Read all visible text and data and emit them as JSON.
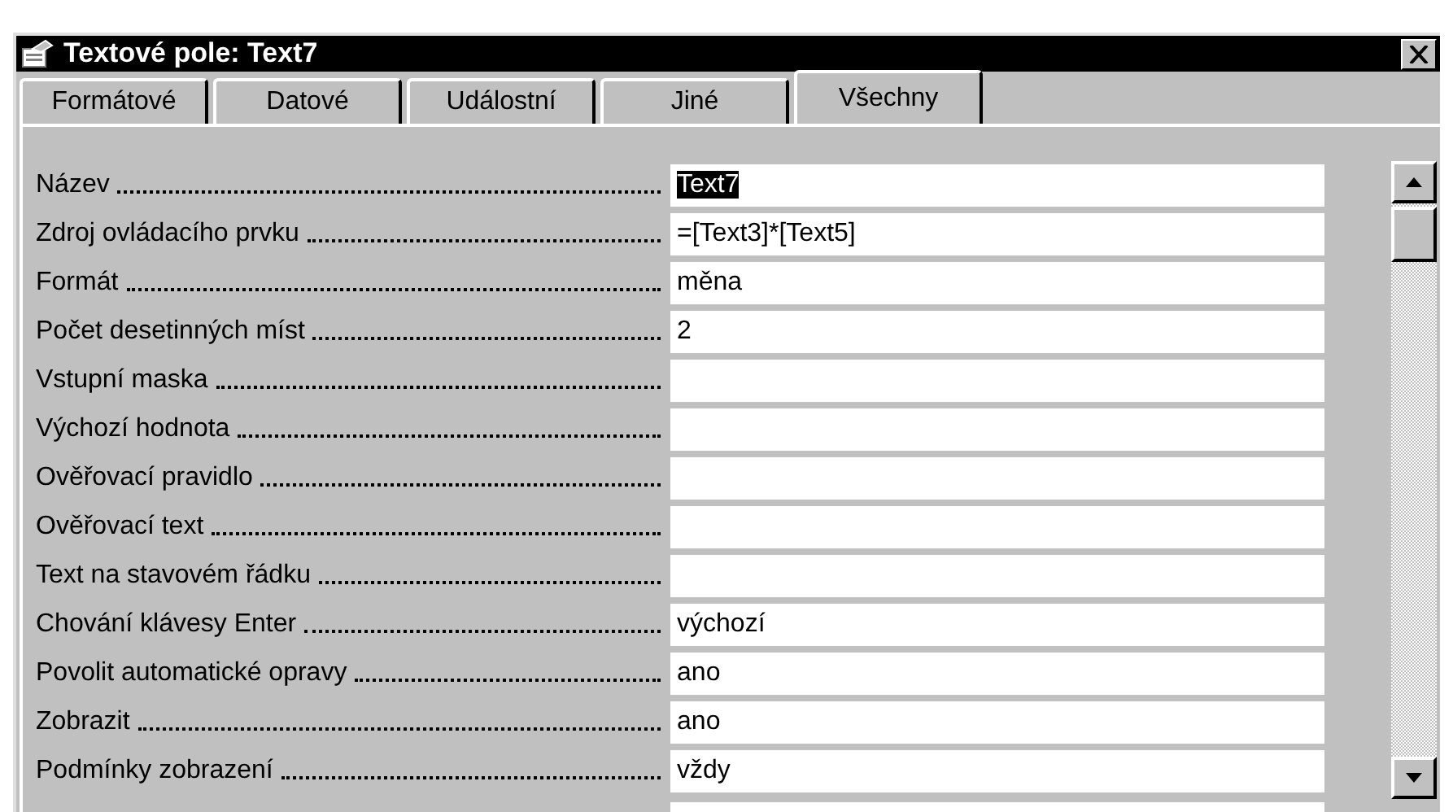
{
  "window": {
    "title": "Textové pole: Text7"
  },
  "tabs": [
    {
      "label": "Formátové",
      "selected": false
    },
    {
      "label": "Datové",
      "selected": false
    },
    {
      "label": "Událostní",
      "selected": false
    },
    {
      "label": "Jiné",
      "selected": false
    },
    {
      "label": "Všechny",
      "selected": true
    }
  ],
  "properties": [
    {
      "name": "Název",
      "value": "Text7",
      "selected": true
    },
    {
      "name": "Zdroj ovládacího prvku",
      "value": "=[Text3]*[Text5]",
      "selected": false
    },
    {
      "name": "Formát",
      "value": "měna",
      "selected": false
    },
    {
      "name": "Počet desetinných míst",
      "value": "2",
      "selected": false
    },
    {
      "name": "Vstupní maska",
      "selected": false
    },
    {
      "name": "Výchozí hodnota",
      "selected": false
    },
    {
      "name": "Ověřovací pravidlo",
      "selected": false
    },
    {
      "name": "Ověřovací text",
      "selected": false
    },
    {
      "name": "Text na stavovém řádku",
      "selected": false
    },
    {
      "name": "Chování klávesy Enter",
      "value": "výchozí",
      "selected": false
    },
    {
      "name": "Povolit automatické opravy",
      "value": "ano",
      "selected": false
    },
    {
      "name": "Zobrazit",
      "value": "ano",
      "selected": false
    },
    {
      "name": "Podmínky zobrazení",
      "value": "vždy",
      "selected": false
    }
  ]
}
